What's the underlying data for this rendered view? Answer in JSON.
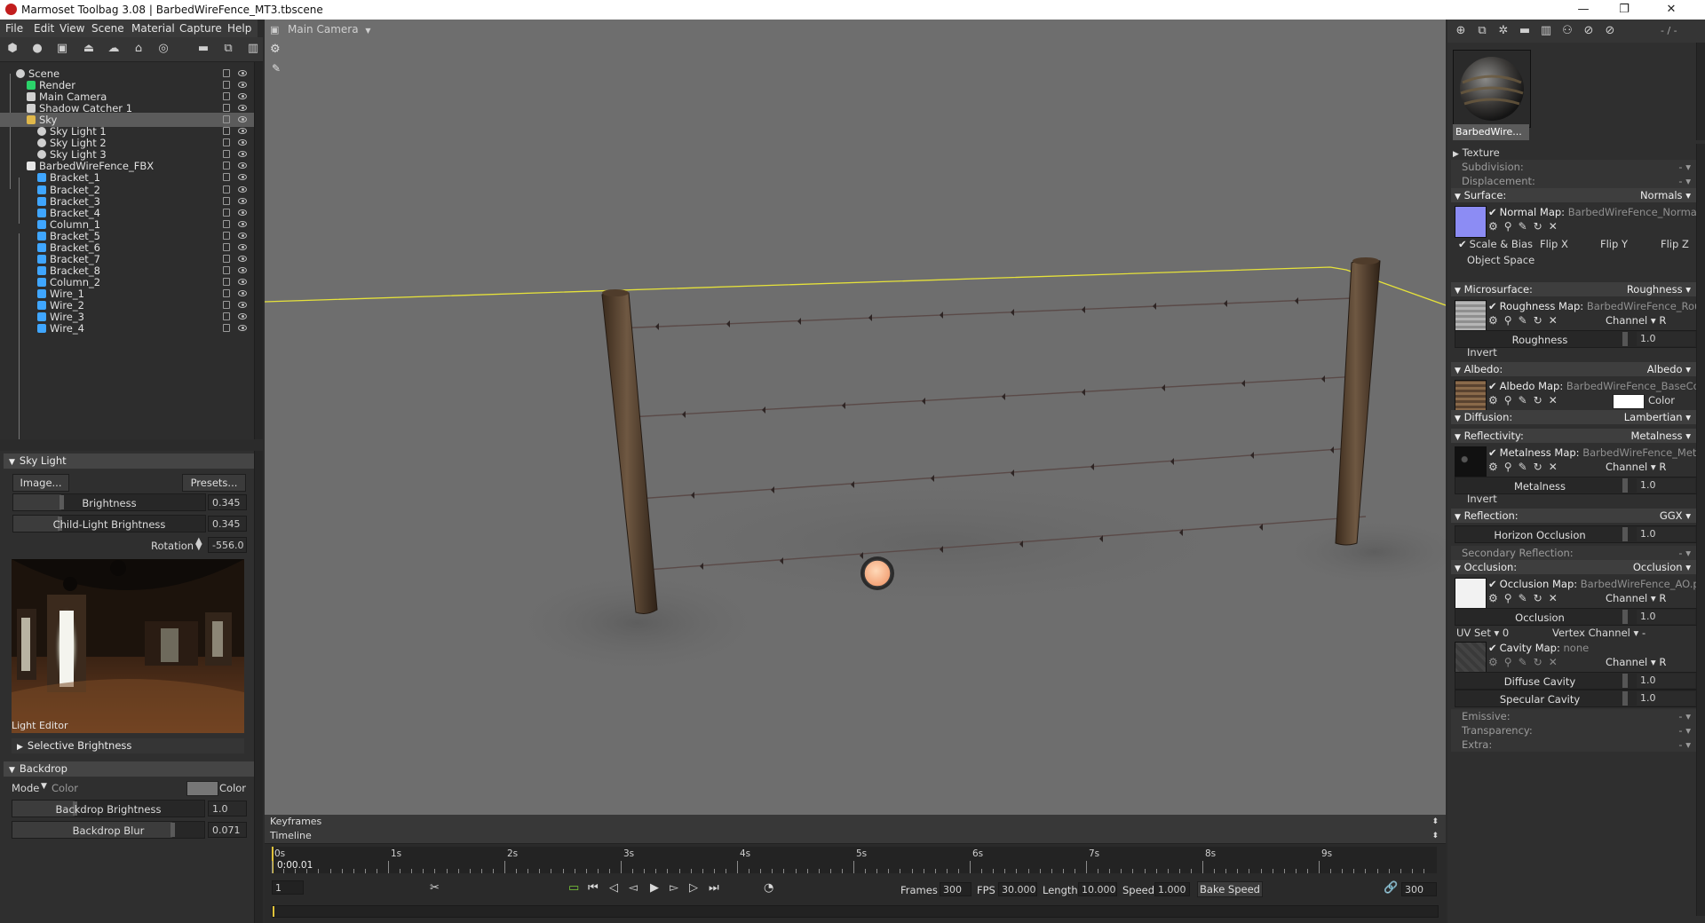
{
  "titlebar": {
    "title": "Marmoset Toolbag 3.08  |  BarbedWireFence_MT3.tbscene",
    "minimize": "—",
    "restore": "❐",
    "close": "✕"
  },
  "menu": [
    "File",
    "Edit",
    "View",
    "Scene",
    "Material",
    "Capture",
    "Help"
  ],
  "outliner": {
    "items": [
      {
        "label": "Scene",
        "icon": "scene-icon"
      },
      {
        "label": "Render",
        "icon": "render-icon"
      },
      {
        "label": "Main Camera",
        "icon": "camera-icon"
      },
      {
        "label": "Shadow Catcher 1",
        "icon": "shadow-catcher-icon"
      },
      {
        "label": "Sky",
        "icon": "sky-icon"
      },
      {
        "label": "Sky Light 1",
        "icon": "light-icon"
      },
      {
        "label": "Sky Light 2",
        "icon": "light-icon"
      },
      {
        "label": "Sky Light 3",
        "icon": "light-icon"
      },
      {
        "label": "BarbedWireFence_FBX",
        "icon": "model-icon"
      },
      {
        "label": "Bracket_1",
        "icon": "mesh-icon"
      },
      {
        "label": "Bracket_2",
        "icon": "mesh-icon"
      },
      {
        "label": "Bracket_3",
        "icon": "mesh-icon"
      },
      {
        "label": "Bracket_4",
        "icon": "mesh-icon"
      },
      {
        "label": "Column_1",
        "icon": "mesh-icon"
      },
      {
        "label": "Bracket_5",
        "icon": "mesh-icon"
      },
      {
        "label": "Bracket_6",
        "icon": "mesh-icon"
      },
      {
        "label": "Bracket_7",
        "icon": "mesh-icon"
      },
      {
        "label": "Bracket_8",
        "icon": "mesh-icon"
      },
      {
        "label": "Column_2",
        "icon": "mesh-icon"
      },
      {
        "label": "Wire_1",
        "icon": "mesh-icon"
      },
      {
        "label": "Wire_2",
        "icon": "mesh-icon"
      },
      {
        "label": "Wire_3",
        "icon": "mesh-icon"
      },
      {
        "label": "Wire_4",
        "icon": "mesh-icon"
      }
    ],
    "selected": "Sky"
  },
  "skylight": {
    "header": "Sky Light",
    "image_btn": "Image...",
    "presets_btn": "Presets...",
    "brightness_label": "Brightness",
    "brightness_value": "0.345",
    "child_label": "Child-Light Brightness",
    "child_value": "0.345",
    "rotation_label": "Rotation",
    "rotation_value": "-556.0",
    "light_editor_label": "Light Editor",
    "selective_label": "Selective Brightness"
  },
  "backdrop": {
    "header": "Backdrop",
    "mode_label": "Mode",
    "mode_value": "Color",
    "color_label": "Color",
    "brightness_label": "Backdrop Brightness",
    "brightness_value": "1.0",
    "blur_label": "Backdrop Blur",
    "blur_value": "0.071"
  },
  "viewport": {
    "camera": "Main Camera"
  },
  "timeline": {
    "keyframes": "Keyframes",
    "timeline": "Timeline",
    "ticks": [
      "0s",
      "1s",
      "2s",
      "3s",
      "4s",
      "5s",
      "6s",
      "7s",
      "8s",
      "9s"
    ],
    "current_time": "0:00.01",
    "frame_value": "1",
    "frames_label": "Frames",
    "frames_value": "300",
    "fps_label": "FPS",
    "fps_value": "30.000",
    "length_label": "Length",
    "length_value": "10.000",
    "speed_label": "Speed",
    "speed_value": "1.000",
    "bake_label": "Bake Speed",
    "end_value": "300"
  },
  "material": {
    "name": "BarbedWire...",
    "toolbar_extra": "- / -",
    "texture": "Texture",
    "subdivision": "Subdivision:",
    "displacement": "Displacement:",
    "dash": "-",
    "surface": {
      "label": "Surface:",
      "value": "Normals",
      "map_label": "Normal Map:",
      "map_file": "BarbedWireFence_Normal...",
      "scale_bias": "Scale & Bias",
      "flip_x": "Flip X",
      "flip_y": "Flip Y",
      "flip_z": "Flip Z",
      "object_space": "Object Space"
    },
    "microsurface": {
      "label": "Microsurface:",
      "value": "Roughness",
      "map_label": "Roughness Map:",
      "map_file": "BarbedWireFence_Roug...",
      "channel": "Channel",
      "channel_value": "R",
      "slider_label": "Roughness",
      "slider_value": "1.0",
      "invert": "Invert"
    },
    "albedo": {
      "label": "Albedo:",
      "value": "Albedo",
      "map_label": "Albedo Map:",
      "map_file": "BarbedWireFence_BaseCol...",
      "color_label": "Color"
    },
    "diffusion": {
      "label": "Diffusion:",
      "value": "Lambertian"
    },
    "reflectivity": {
      "label": "Reflectivity:",
      "value": "Metalness",
      "map_label": "Metalness Map:",
      "map_file": "BarbedWireFence_Metal...",
      "channel": "Channel",
      "channel_value": "R",
      "slider_label": "Metalness",
      "slider_value": "1.0",
      "invert": "Invert"
    },
    "reflection": {
      "label": "Reflection:",
      "value": "GGX",
      "slider_label": "Horizon Occlusion",
      "slider_value": "1.0"
    },
    "secondary": {
      "label": "Secondary Reflection:"
    },
    "occlusion": {
      "label": "Occlusion:",
      "value": "Occlusion",
      "map_label": "Occlusion Map:",
      "map_file": "BarbedWireFence_AO.p...",
      "channel": "Channel",
      "channel_value": "R",
      "slider_label": "Occlusion",
      "slider_value": "1.0",
      "uvset_label": "UV Set",
      "uvset_value": "0",
      "vertex_label": "Vertex Channel",
      "vertex_value": "-",
      "cavity_label": "Cavity Map:",
      "cavity_file": "none",
      "cavity_channel_value": "R",
      "diffuse_cavity": "Diffuse Cavity",
      "diffuse_cavity_value": "1.0",
      "specular_cavity": "Specular Cavity",
      "specular_cavity_value": "1.0"
    },
    "emissive": "Emissive:",
    "transparency": "Transparency:",
    "extra": "Extra:"
  }
}
